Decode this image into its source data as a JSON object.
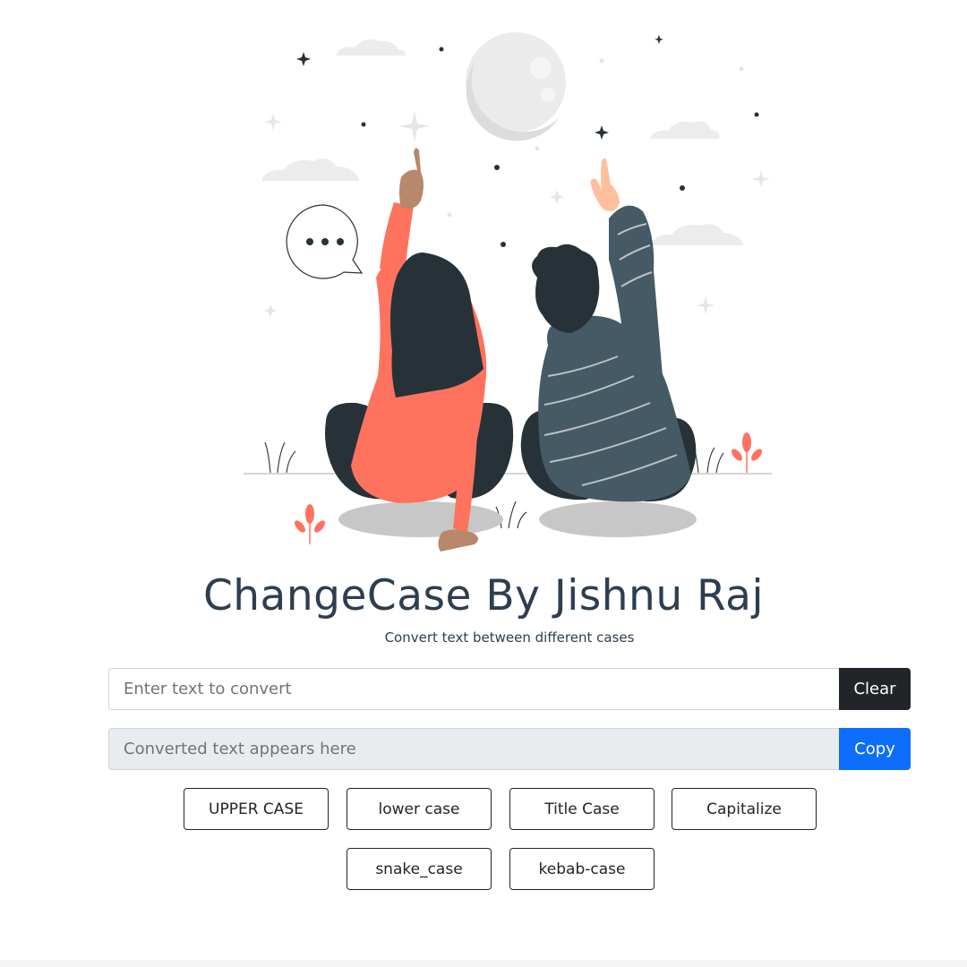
{
  "colors": {
    "title": "#2c3e50",
    "clear_button": "#212529",
    "copy_button": "#0d6efd",
    "output_background": "#e9ecef",
    "sweater": "#ff725e",
    "hair": "#263238",
    "shirt": "#455a64",
    "moon": "#ebebeb"
  },
  "header": {
    "title": "ChangeCase By Jishnu Raj",
    "subtitle": "Convert text between different cases"
  },
  "input": {
    "value": "",
    "placeholder": "Enter text to convert",
    "clear_label": "Clear"
  },
  "output": {
    "value": "",
    "placeholder": "Converted text appears here",
    "copy_label": "Copy"
  },
  "case_buttons": [
    "UPPER CASE",
    "lower case",
    "Title Case",
    "Capitalize",
    "snake_case",
    "kebab-case"
  ],
  "illustration": {
    "speech_bubble": "•••",
    "icons": [
      "moon-icon",
      "star-icon",
      "cloud-icon",
      "speech-bubble-icon",
      "plant-icon",
      "grass-icon"
    ]
  }
}
